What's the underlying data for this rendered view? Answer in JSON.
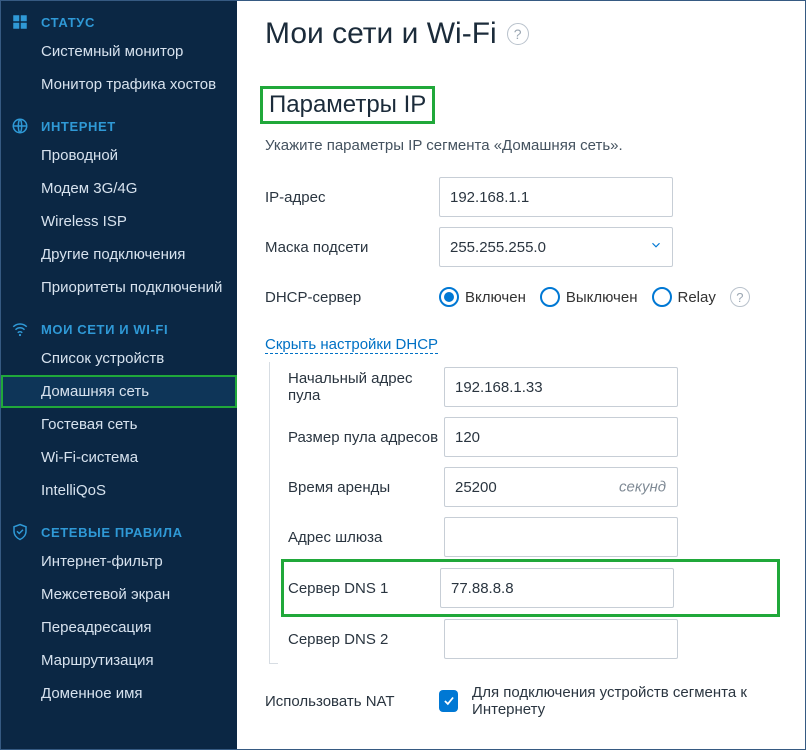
{
  "sidebar": {
    "groups": [
      {
        "key": "status",
        "title": "СТАТУС",
        "icon": "dashboard-icon",
        "items": [
          "Системный монитор",
          "Монитор трафика хостов"
        ]
      },
      {
        "key": "internet",
        "title": "ИНТЕРНЕТ",
        "icon": "globe-icon",
        "items": [
          "Проводной",
          "Модем 3G/4G",
          "Wireless ISP",
          "Другие подключения",
          "Приоритеты подключений"
        ]
      },
      {
        "key": "mynet",
        "title": "МОИ СЕТИ И WI-FI",
        "icon": "wifi-icon",
        "items": [
          "Список устройств",
          "Домашняя сеть",
          "Гостевая сеть",
          "Wi-Fi-система",
          "IntelliQoS"
        ],
        "active_index": 1,
        "highlight_index": 1
      },
      {
        "key": "rules",
        "title": "СЕТЕВЫЕ ПРАВИЛА",
        "icon": "shield-icon",
        "items": [
          "Интернет-фильтр",
          "Межсетевой экран",
          "Переадресация",
          "Маршрутизация",
          "Доменное имя"
        ]
      }
    ]
  },
  "main": {
    "page_title": "Мои сети и Wi-Fi",
    "section_title": "Параметры IP",
    "section_desc": "Укажите параметры IP сегмента «Домашняя сеть».",
    "labels": {
      "ip": "IP-адрес",
      "mask": "Маска подсети",
      "dhcp": "DHCP-сервер",
      "toggle": "Скрыть настройки DHCP",
      "pool_start": "Начальный адрес пула",
      "pool_size": "Размер пула адресов",
      "lease": "Время аренды",
      "lease_unit": "секунд",
      "gateway": "Адрес шлюза",
      "dns1": "Сервер DNS 1",
      "dns2": "Сервер DNS 2",
      "nat": "Использовать NAT",
      "nat_desc": "Для подключения устройств сегмента к Интернету"
    },
    "values": {
      "ip": "192.168.1.1",
      "mask": "255.255.255.0",
      "pool_start": "192.168.1.33",
      "pool_size": "120",
      "lease": "25200",
      "gateway": "",
      "dns1": "77.88.8.8",
      "dns2": ""
    },
    "dhcp_options": {
      "on": "Включен",
      "off": "Выключен",
      "relay": "Relay",
      "selected": "on"
    },
    "nat_checked": true,
    "highlights": {
      "section_title": true,
      "dns1_row": true
    }
  }
}
